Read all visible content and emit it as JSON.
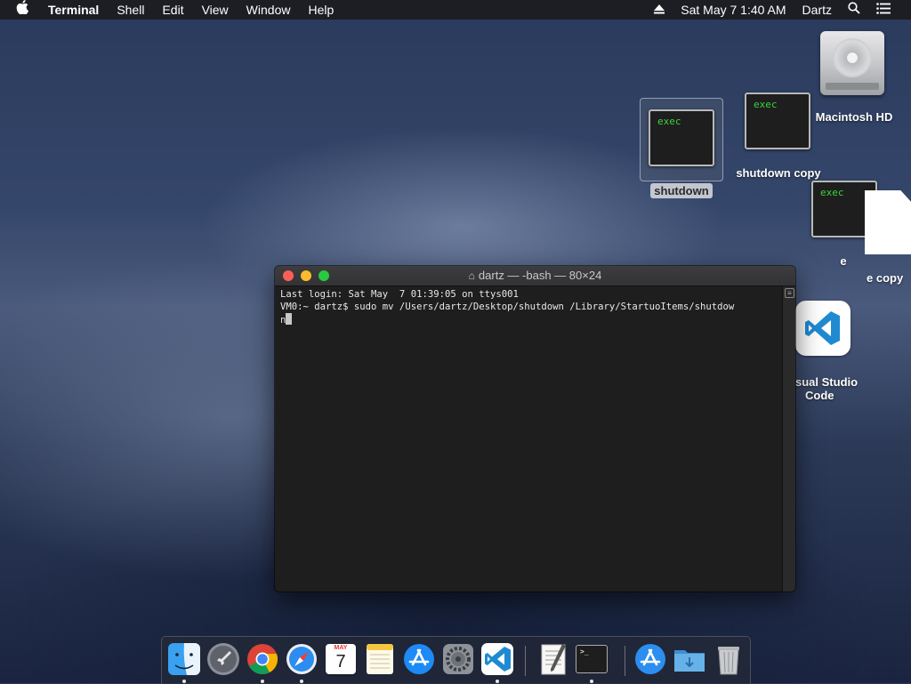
{
  "menubar": {
    "app": "Terminal",
    "menus": [
      "Shell",
      "Edit",
      "View",
      "Window",
      "Help"
    ],
    "datetime": "Sat May 7  1:40 AM",
    "user": "Dartz"
  },
  "desktop": {
    "icons": [
      {
        "label": "shutdown",
        "badge": "exec"
      },
      {
        "label": "shutdown copy",
        "badge": "exec"
      },
      {
        "label": "Macintosh HD"
      },
      {
        "label": "e",
        "badge": "exec"
      },
      {
        "label": "e copy"
      },
      {
        "label_line1": "sual Studio",
        "label_line2": "Code"
      }
    ]
  },
  "terminal": {
    "title": "dartz — -bash — 80×24",
    "lines": [
      "Last login: Sat May  7 01:39:05 on ttys001",
      "VM0:~ dartz$ sudo mv /Users/dartz/Desktop/shutdown /Library/StartuoItems/shutdow",
      "n"
    ]
  },
  "dock": {
    "calendar_month": "MAY",
    "calendar_day": "7",
    "terminal_prompt": ">_"
  }
}
